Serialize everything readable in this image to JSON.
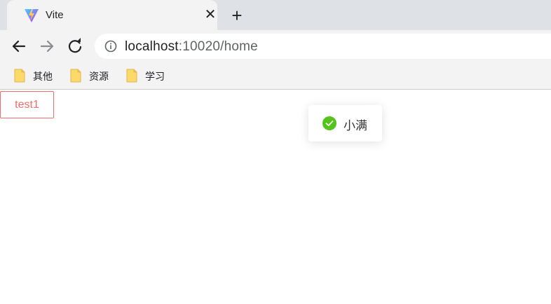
{
  "tab": {
    "title": "Vite",
    "close_glyph": "✕",
    "icon": "vite-logo-icon"
  },
  "newtab": {
    "glyph": "+"
  },
  "toolbar": {
    "back_icon": "arrow-left-icon",
    "forward_icon": "arrow-right-icon",
    "reload_icon": "reload-icon",
    "url_host": "localhost",
    "url_path": ":10020/home"
  },
  "bookmarks": [
    {
      "label": "其他",
      "icon": "folder-icon"
    },
    {
      "label": "资源",
      "icon": "folder-icon"
    },
    {
      "label": "学习",
      "icon": "folder-icon"
    }
  ],
  "page": {
    "test_button_label": "test1",
    "toast": {
      "text": "小满",
      "icon": "check-circle-icon",
      "type": "success"
    }
  },
  "colors": {
    "tab_strip": "#dee1e6",
    "toolbar": "#f3f3f4",
    "danger": "#f56c6c",
    "success": "#52c41a",
    "folder": "#fbd96a"
  }
}
